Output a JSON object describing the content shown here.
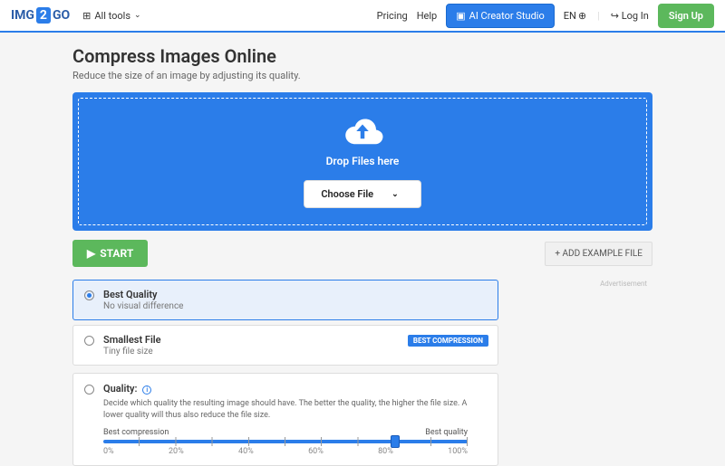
{
  "header": {
    "logo_left": "IMG",
    "logo_badge": "2",
    "logo_right": "GO",
    "all_tools": "All tools",
    "pricing": "Pricing",
    "help": "Help",
    "ai_creator": "AI Creator Studio",
    "lang": "EN",
    "login": "Log In",
    "signup": "Sign Up"
  },
  "page": {
    "title": "Compress Images Online",
    "subtitle": "Reduce the size of an image by adjusting its quality."
  },
  "dropzone": {
    "text": "Drop Files here",
    "choose": "Choose File"
  },
  "actions": {
    "start": "START",
    "add_example": "+ ADD EXAMPLE FILE"
  },
  "ad_label": "Advertisement",
  "options": {
    "best_quality": {
      "title": "Best Quality",
      "desc": "No visual difference"
    },
    "smallest": {
      "title": "Smallest File",
      "desc": "Tiny file size",
      "badge": "BEST COMPRESSION"
    }
  },
  "quality": {
    "title": "Quality:",
    "desc": "Decide which quality the resulting image should have. The better the quality, the higher the file size. A lower quality will thus also reduce the file size.",
    "left_label": "Best compression",
    "right_label": "Best quality",
    "ticks": {
      "t0": "0%",
      "t1": "20%",
      "t2": "40%",
      "t3": "60%",
      "t4": "80%",
      "t5": "100%"
    }
  }
}
